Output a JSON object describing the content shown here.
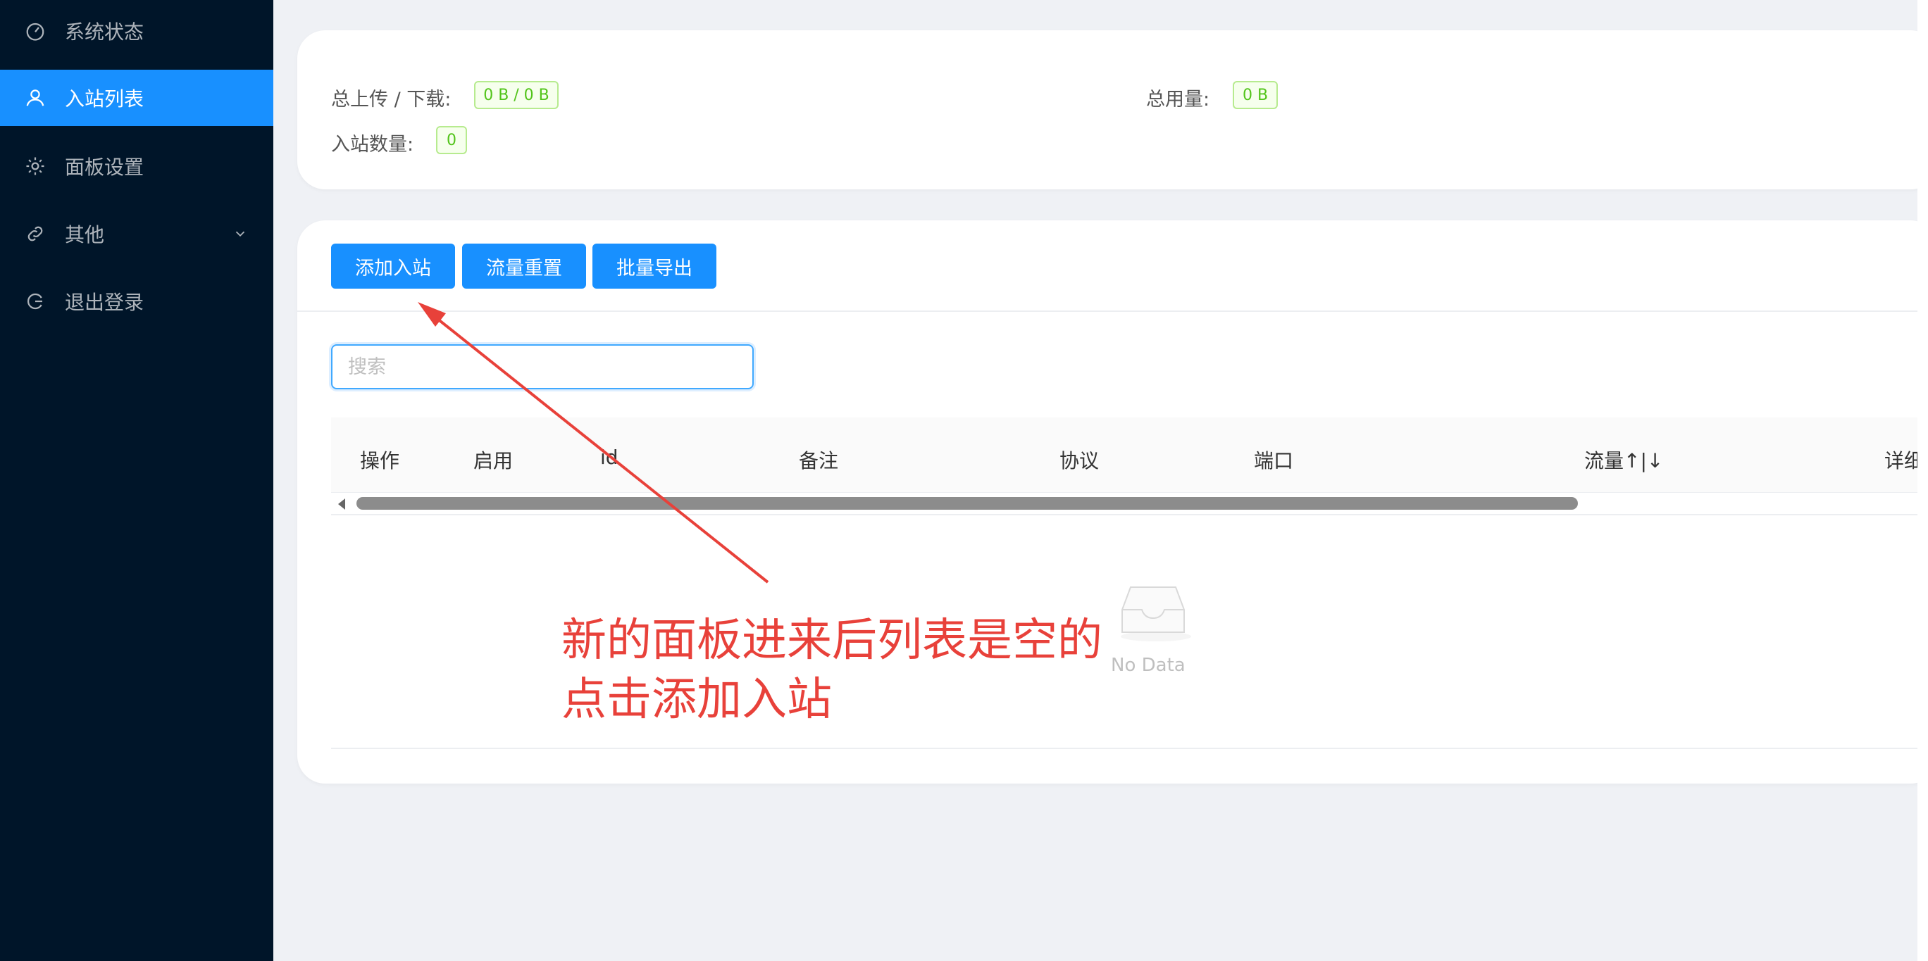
{
  "sidebar": {
    "items": [
      {
        "label": "系统状态",
        "icon": "dashboard-icon"
      },
      {
        "label": "入站列表",
        "icon": "user-icon",
        "active": true
      },
      {
        "label": "面板设置",
        "icon": "gear-icon"
      },
      {
        "label": "其他",
        "icon": "link-icon",
        "has_submenu": true
      },
      {
        "label": "退出登录",
        "icon": "logout-icon"
      }
    ]
  },
  "stats": {
    "upload_download_label": "总上传 / 下载:",
    "upload_download_value": "0 B / 0 B",
    "total_usage_label": "总用量:",
    "total_usage_value": "0 B",
    "inbound_count_label": "入站数量:",
    "inbound_count_value": "0"
  },
  "toolbar": {
    "add_inbound": "添加入站",
    "reset_traffic": "流量重置",
    "batch_export": "批量导出"
  },
  "search": {
    "placeholder": "搜索",
    "value": ""
  },
  "table": {
    "columns": [
      "操作",
      "启用",
      "id",
      "备注",
      "协议",
      "端口",
      "流量↑|↓",
      "详细"
    ],
    "rows": [],
    "empty_text": "No Data"
  },
  "annotation": {
    "line1": "新的面板进来后列表是空的",
    "line2": "点击添加入站",
    "color": "#e8413a"
  },
  "colors": {
    "sidebar_bg": "#001529",
    "primary": "#1890ff",
    "tag_green": "#52c41a"
  }
}
